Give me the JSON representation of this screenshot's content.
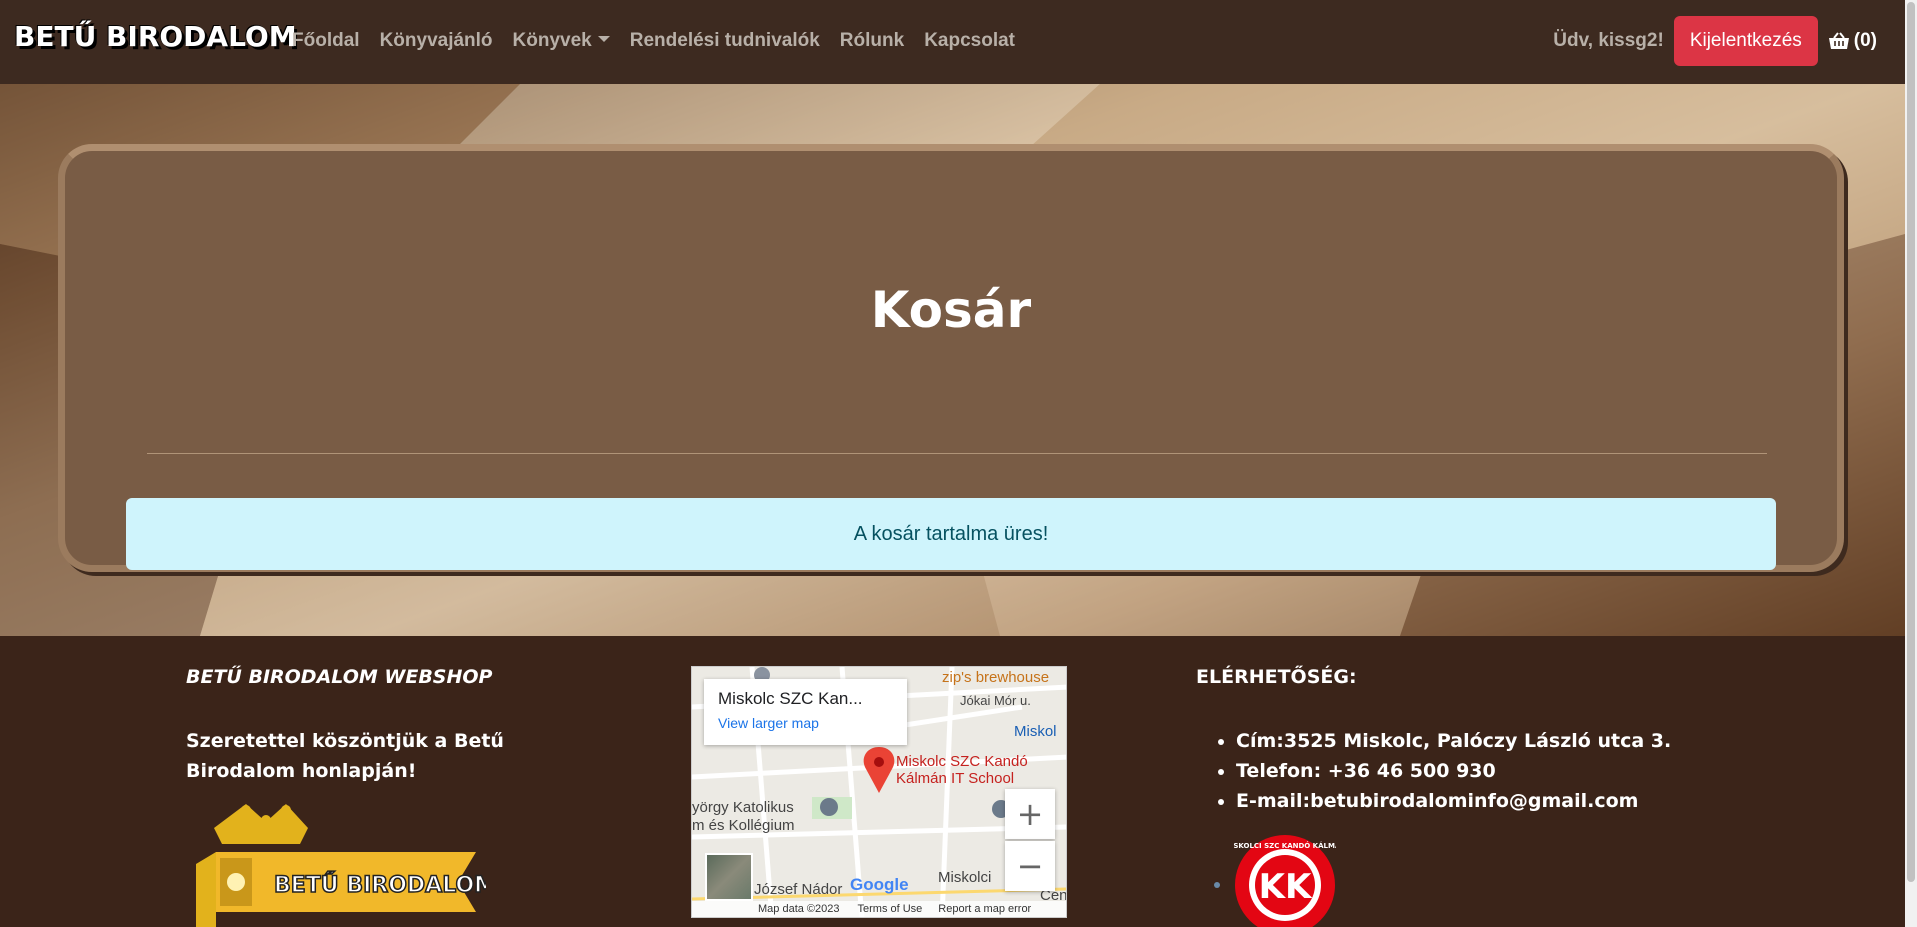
{
  "brand": "BETŰ BIRODALOM",
  "nav": {
    "links": [
      "Főoldal",
      "Könyvajánló",
      "Könyvek",
      "Rendelési tudnivalók",
      "Rólunk",
      "Kapcsolat"
    ],
    "greeting": "Üdv, kissg2!",
    "logout_label": "Kijelentkezés",
    "cart_label": "(0)"
  },
  "main": {
    "title": "Kosár",
    "alert": "A kosár tartalma üres!"
  },
  "footer": {
    "shop_title": "BETŰ BIRODALOM WEBSHOP",
    "welcome": "Szeretettel köszöntjük a Betű Birodalom honlapján!",
    "logo_text": "BETŰ BIRODALOM",
    "map": {
      "place_title": "Miskolc SZC Kan...",
      "larger_map_link": "View larger map",
      "pin_label_line1": "Miskolc SZC Kandó",
      "pin_label_line2": "Kálmán IT School",
      "labels": [
        "zip's brewhouse",
        "Jókai Mór u.",
        "Miskol",
        "yörgy Katolikus",
        "m és Kollégium",
        "Miskolci",
        "József Nádor",
        "Cen"
      ],
      "zoom_in": "+",
      "zoom_out": "−",
      "attribution": [
        "Map data ©2023",
        "Terms of Use",
        "Report a map error"
      ],
      "google": "Google"
    },
    "contact_title": "ELÉRHETŐSÉG:",
    "contacts": [
      "Cím:3525 Miskolc, Palóczy László utca 3.",
      "Telefon: +36 46 500 930",
      "E-mail:betubirodalominfo@gmail.com"
    ],
    "school_logo_text": "KK",
    "school_logo_ring": "MISKOLCI SZC KANDÓ KÁLMÁN"
  },
  "colors": {
    "navbar": "#3d2a20",
    "card": "#795c45",
    "alert_bg": "#cff4fc",
    "logout": "#dc3545",
    "footer": "#3b2419"
  }
}
